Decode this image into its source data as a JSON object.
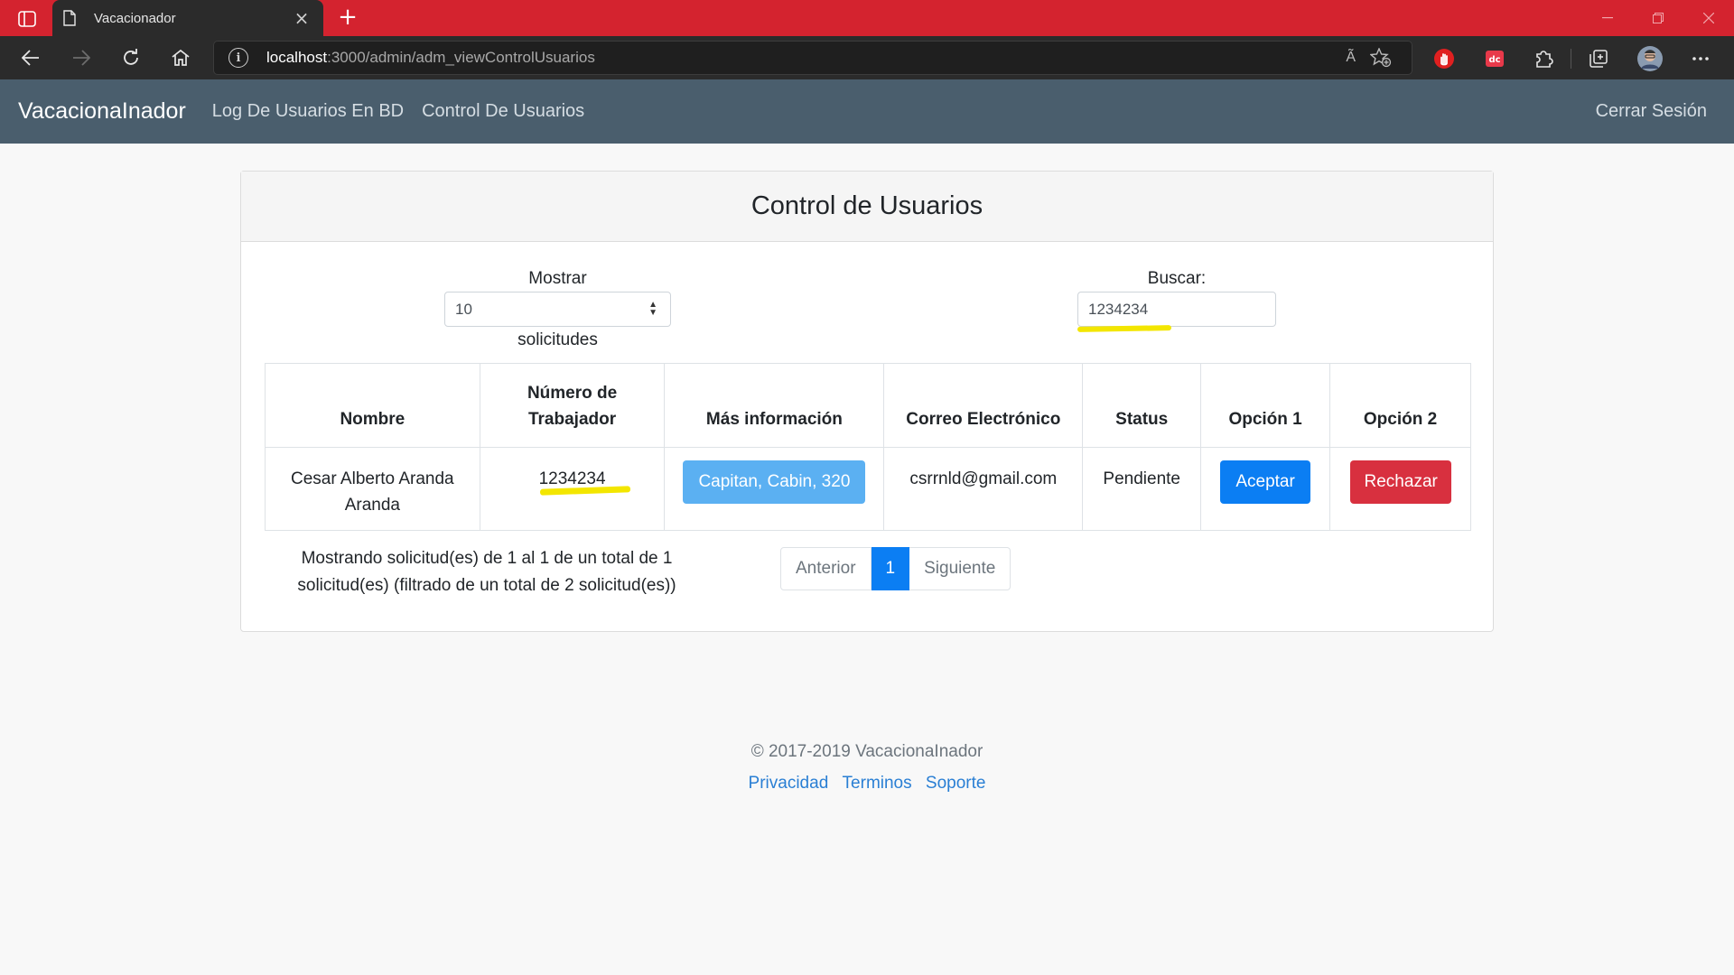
{
  "browser": {
    "tab_title": "Vacacionador",
    "tab_close": "×",
    "new_tab": "+",
    "url_host": "localhost",
    "url_path": ":3000/admin/adm_viewControlUsuarios",
    "read_aloud": "Ã",
    "icons": [
      "tab-actions-icon",
      "page-icon",
      "back-arrow-icon",
      "forward-arrow-icon",
      "refresh-icon",
      "home-icon",
      "site-info-icon",
      "read-aloud-icon",
      "favorite-star-icon",
      "adblock-hand-icon",
      "dictionary-extension-icon",
      "extensions-puzzle-icon",
      "collections-icon",
      "profile-avatar-icon",
      "more-menu-icon"
    ],
    "accent_color": "#d4232f"
  },
  "navbar": {
    "brand": "VacacionaInador",
    "links": [
      "Log De Usuarios En BD",
      "Control De Usuarios"
    ],
    "logout": "Cerrar Sesión",
    "bg_color": "#4a5e6d"
  },
  "card": {
    "title": "Control de Usuarios",
    "show_label": "Mostrar",
    "show_value": "10",
    "show_suffix": "solicitudes",
    "search_label": "Buscar:",
    "search_value": "1234234"
  },
  "table": {
    "headers": [
      "Nombre",
      "Número de Trabajador",
      "Más información",
      "Correo Electrónico",
      "Status",
      "Opción 1",
      "Opción 2"
    ],
    "rows": [
      {
        "nombre": "Cesar Alberto Aranda Aranda",
        "numero": "1234234",
        "info": "Capitan, Cabin, 320",
        "correo": "csrrnld@gmail.com",
        "status": "Pendiente",
        "opcion1": "Aceptar",
        "opcion2": "Rechazar"
      }
    ]
  },
  "pagination": {
    "summary": "Mostrando solicitud(es) de 1 al 1 de un total de 1 solicitud(es) (filtrado de un total de 2 solicitud(es))",
    "prev": "Anterior",
    "current": "1",
    "next": "Siguiente"
  },
  "footer": {
    "copyright": "© 2017-2019 VacacionaInador",
    "links": [
      "Privacidad",
      "Terminos",
      "Soporte"
    ]
  },
  "colors": {
    "primary": "#0b7ef3",
    "info": "#5bb0f2",
    "danger": "#d8303f",
    "highlight": "#f3e600"
  }
}
